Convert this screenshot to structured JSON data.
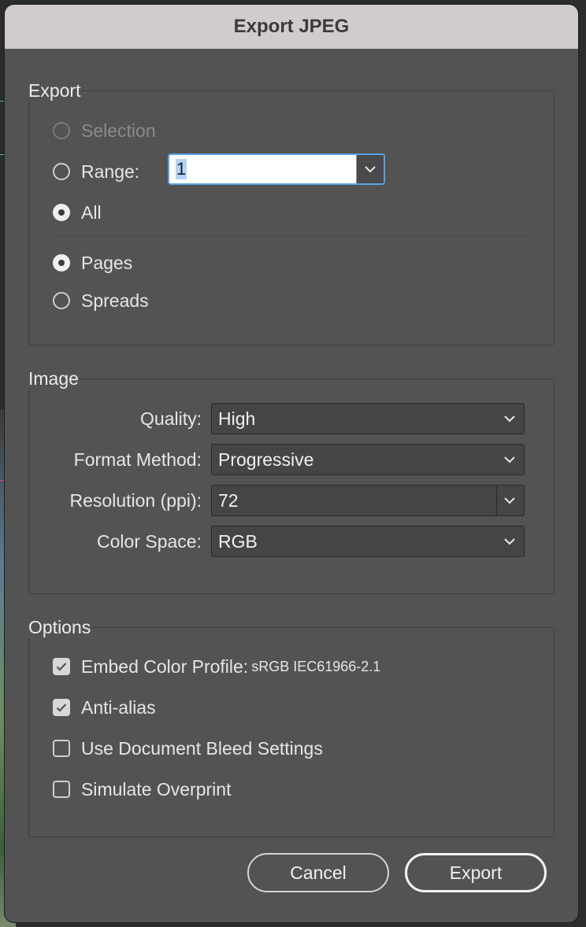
{
  "dialog": {
    "title": "Export JPEG"
  },
  "export_group": {
    "title": "Export",
    "selection_label": "Selection",
    "range_label": "Range:",
    "range_value": "1",
    "all_label": "All",
    "pages_label": "Pages",
    "spreads_label": "Spreads",
    "selected_scope": "All",
    "selected_layout": "Pages"
  },
  "image_group": {
    "title": "Image",
    "quality_label": "Quality:",
    "quality_value": "High",
    "format_label": "Format Method:",
    "format_value": "Progressive",
    "resolution_label": "Resolution (ppi):",
    "resolution_value": "72",
    "colorspace_label": "Color Space:",
    "colorspace_value": "RGB"
  },
  "options_group": {
    "title": "Options",
    "embed_label": "Embed Color Profile:",
    "embed_value": "sRGB IEC61966-2.1",
    "embed_checked": true,
    "antialias_label": "Anti-alias",
    "antialias_checked": true,
    "bleed_label": "Use Document Bleed Settings",
    "bleed_checked": false,
    "overprint_label": "Simulate Overprint",
    "overprint_checked": false
  },
  "buttons": {
    "cancel": "Cancel",
    "export": "Export"
  },
  "colors": {
    "dialog_bg": "#535353",
    "titlebar_bg": "#d2cbcb",
    "focus_ring": "#5aa2e6"
  },
  "icons": {
    "dropdown": "chevron-down-icon",
    "check": "checkmark-icon"
  }
}
